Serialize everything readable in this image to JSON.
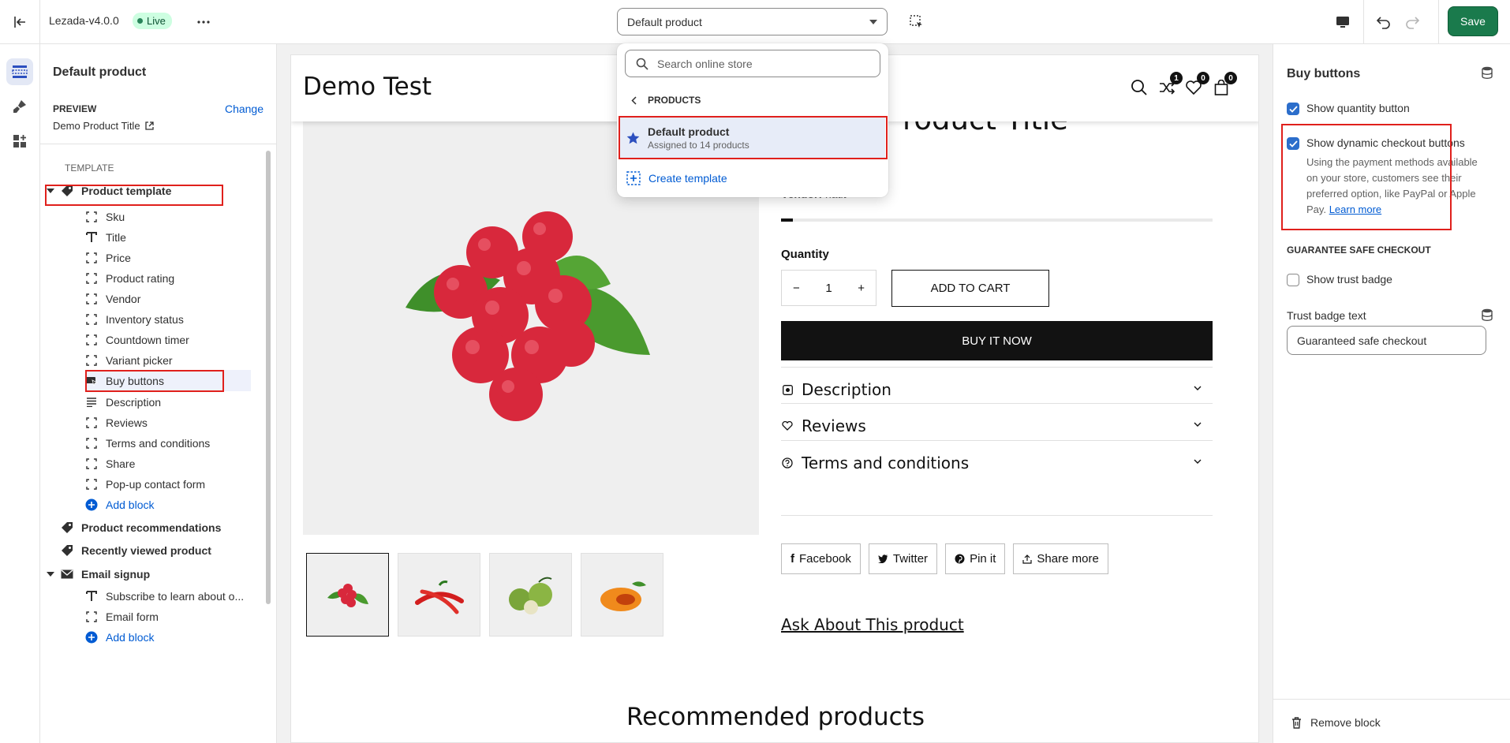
{
  "topbar": {
    "theme_name": "Lezada-v4.0.0",
    "live_badge": "Live",
    "template_select": "Default product",
    "save_label": "Save"
  },
  "sidebar": {
    "title": "Default product",
    "preview_label": "PREVIEW",
    "change_label": "Change",
    "preview_value": "Demo Product Title",
    "template_label": "TEMPLATE",
    "sections": [
      {
        "label": "Product template",
        "expanded": true,
        "icon": "tag-icon",
        "blocks": [
          {
            "label": "Sku",
            "icon": "block-icon"
          },
          {
            "label": "Title",
            "icon": "text-icon"
          },
          {
            "label": "Price",
            "icon": "block-icon"
          },
          {
            "label": "Product rating",
            "icon": "block-icon"
          },
          {
            "label": "Vendor",
            "icon": "block-icon"
          },
          {
            "label": "Inventory status",
            "icon": "block-icon"
          },
          {
            "label": "Countdown timer",
            "icon": "block-icon"
          },
          {
            "label": "Variant picker",
            "icon": "block-icon"
          },
          {
            "label": "Buy buttons",
            "icon": "buy-button-icon",
            "selected": true
          },
          {
            "label": "Description",
            "icon": "paragraph-icon"
          },
          {
            "label": "Reviews",
            "icon": "block-icon"
          },
          {
            "label": "Terms and conditions",
            "icon": "block-icon"
          },
          {
            "label": "Share",
            "icon": "block-icon"
          },
          {
            "label": "Pop-up contact form",
            "icon": "block-icon"
          }
        ],
        "add_block": "Add block"
      },
      {
        "label": "Product recommendations",
        "icon": "tag-icon"
      },
      {
        "label": "Recently viewed product",
        "icon": "tag-icon"
      },
      {
        "label": "Email signup",
        "expanded": true,
        "icon": "email-icon",
        "blocks": [
          {
            "label": "Subscribe to learn about o...",
            "icon": "text-icon"
          },
          {
            "label": "Email form",
            "icon": "block-icon"
          }
        ],
        "add_block": "Add block"
      }
    ]
  },
  "popover": {
    "search_placeholder": "Search online store",
    "back_label": "PRODUCTS",
    "item_title": "Default product",
    "item_sub": "Assigned to 14 products",
    "create_label": "Create template"
  },
  "preview": {
    "store_title": "Demo Test",
    "compare_count": "1",
    "wishlist_count": "0",
    "cart_count": "0",
    "product_title_partial": "roduct Title",
    "vendor_label": "Vendor:",
    "vendor_value": "natit",
    "quantity_label": "Quantity",
    "qty_minus": "−",
    "qty_value": "1",
    "qty_plus": "+",
    "add_to_cart": "ADD TO CART",
    "buy_now": "BUY IT NOW",
    "accordions": [
      "Description",
      "Reviews",
      "Terms and conditions"
    ],
    "share": [
      "Facebook",
      "Twitter",
      "Pin it",
      "Share more"
    ],
    "ask_link": "Ask About This product",
    "recommended_title": "Recommended products"
  },
  "settings": {
    "title": "Buy buttons",
    "show_quantity": "Show quantity button",
    "show_dynamic": "Show dynamic checkout buttons",
    "dynamic_help": "Using the payment methods available on your store, customers see their preferred option, like PayPal or Apple Pay.",
    "learn_more": "Learn more",
    "guarantee_heading": "GUARANTEE SAFE CHECKOUT",
    "show_trust": "Show trust badge",
    "trust_text_label": "Trust badge text",
    "trust_text_value": "Guaranteed safe checkout",
    "remove_block": "Remove block"
  },
  "colors": {
    "accent": "#005bd3",
    "save": "#1a7a4c",
    "highlight": "#e0201c",
    "checkbox": "#2c6ecb"
  }
}
